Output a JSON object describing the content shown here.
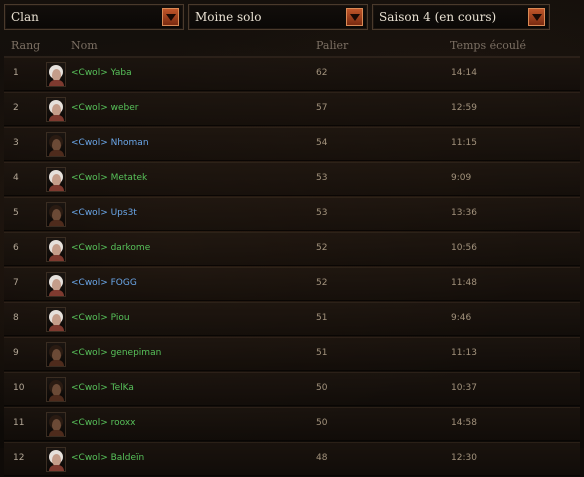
{
  "filters": {
    "category": "Clan",
    "mode": "Moine solo",
    "season": "Saison 4 (en cours)"
  },
  "columns": {
    "rank": "Rang",
    "name": "Nom",
    "tier": "Palier",
    "time": "Temps écoulé"
  },
  "rows": [
    {
      "rank": "1",
      "name": "<Cwol> Yaba",
      "tier": "62",
      "time": "14:14",
      "name_color": "green",
      "avatar": "female-portrait-icon"
    },
    {
      "rank": "2",
      "name": "<Cwol> weber",
      "tier": "57",
      "time": "12:59",
      "name_color": "green",
      "avatar": "female-portrait-icon"
    },
    {
      "rank": "3",
      "name": "<Cwol> Nhoman",
      "tier": "54",
      "time": "11:15",
      "name_color": "blue",
      "avatar": "male-portrait-icon"
    },
    {
      "rank": "4",
      "name": "<Cwol> Metatek",
      "tier": "53",
      "time": "9:09",
      "name_color": "green",
      "avatar": "female-portrait-icon"
    },
    {
      "rank": "5",
      "name": "<Cwol> Ups3t",
      "tier": "53",
      "time": "13:36",
      "name_color": "blue",
      "avatar": "male-portrait-icon"
    },
    {
      "rank": "6",
      "name": "<Cwol> darkome",
      "tier": "52",
      "time": "10:56",
      "name_color": "green",
      "avatar": "female-portrait-icon"
    },
    {
      "rank": "7",
      "name": "<Cwol> FOGG",
      "tier": "52",
      "time": "11:48",
      "name_color": "blue",
      "avatar": "female-portrait-icon"
    },
    {
      "rank": "8",
      "name": "<Cwol> Piou",
      "tier": "51",
      "time": "9:46",
      "name_color": "green",
      "avatar": "female-portrait-icon"
    },
    {
      "rank": "9",
      "name": "<Cwol> genepiman",
      "tier": "51",
      "time": "11:13",
      "name_color": "green",
      "avatar": "male-portrait-icon"
    },
    {
      "rank": "10",
      "name": "<Cwol> TelKa",
      "tier": "50",
      "time": "10:37",
      "name_color": "green",
      "avatar": "male-portrait-icon"
    },
    {
      "rank": "11",
      "name": "<Cwol> rooxx",
      "tier": "50",
      "time": "14:58",
      "name_color": "green",
      "avatar": "male-portrait-icon"
    },
    {
      "rank": "12",
      "name": "<Cwol> Baldeïn",
      "tier": "48",
      "time": "12:30",
      "name_color": "green",
      "avatar": "female-portrait-icon"
    }
  ],
  "colors": {
    "name_green": "#57c15a",
    "name_blue": "#6aa6e8",
    "dropdown_arrow": "#c0562a"
  }
}
